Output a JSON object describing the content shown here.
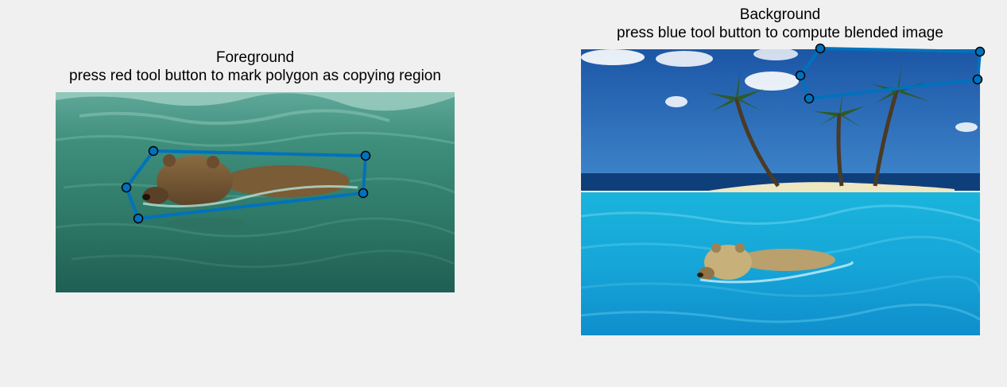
{
  "foreground": {
    "title_line1": "Foreground",
    "title_line2": "press red tool button to mark polygon as copying region"
  },
  "background": {
    "title_line1": "Background",
    "title_line2": "press blue tool button to compute blended image"
  },
  "colors": {
    "figure_background": "#f0f0f0",
    "polygon_line": "#0072bd",
    "vertex_fill": "#0072bd",
    "vertex_edge": "#000000"
  }
}
